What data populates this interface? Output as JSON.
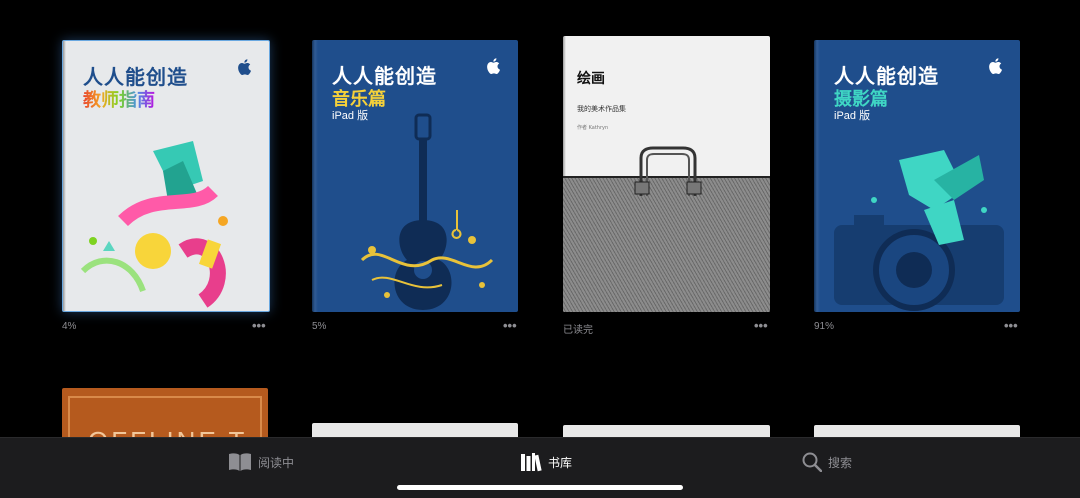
{
  "books": [
    {
      "title": "人人能创造",
      "subtitle": "教师指南",
      "edition": "",
      "progress": "4%",
      "more": "•••"
    },
    {
      "title": "人人能创造",
      "subtitle": "音乐篇",
      "edition": "iPad 版",
      "progress": "5%",
      "more": "•••"
    },
    {
      "title": "绘画",
      "subtitle": "我的美术作品集",
      "author": "作者 Kathryn",
      "progress": "已读完",
      "more": "•••"
    },
    {
      "title": "人人能创造",
      "subtitle": "摄影篇",
      "edition": "iPad 版",
      "progress": "91%",
      "more": "•••"
    }
  ],
  "row2": {
    "first_cover_text": "OFFLINE T"
  },
  "tabbar": {
    "reading_now": "阅读中",
    "library": "书库",
    "search": "搜索"
  },
  "colors": {
    "background": "#000000",
    "tabbar": "#1c1c1e",
    "meta": "#8e8e93",
    "blue_cover": "#1f4e8c",
    "teacher_cover": "#e6e8ea"
  }
}
